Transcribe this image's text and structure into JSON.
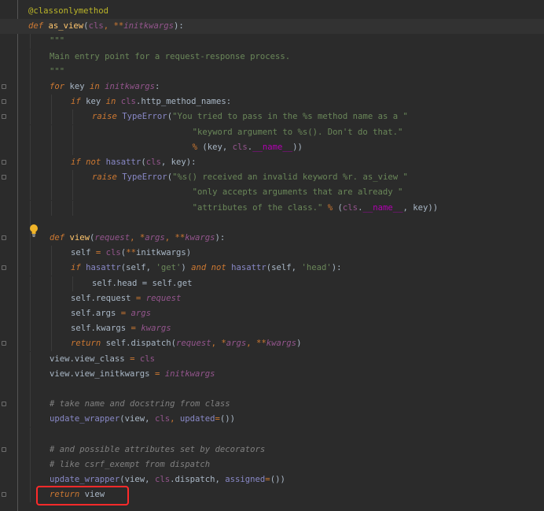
{
  "editor": {
    "lines": [
      {
        "tokens": [
          {
            "t": "@classonlymethod",
            "c": "deco"
          }
        ],
        "indent": 0
      },
      {
        "tokens": [
          {
            "t": "def ",
            "c": "kw"
          },
          {
            "t": "as_view",
            "c": "fn"
          },
          {
            "t": "(",
            "c": "attr"
          },
          {
            "t": "cls",
            "c": "self"
          },
          {
            "t": ", ",
            "c": "op"
          },
          {
            "t": "**",
            "c": "op"
          },
          {
            "t": "initkwargs",
            "c": "paramI"
          },
          {
            "t": "):",
            "c": "attr"
          }
        ],
        "indent": 0,
        "current": true
      },
      {
        "tokens": [
          {
            "t": "\"\"\"",
            "c": "str"
          }
        ],
        "indent": 1
      },
      {
        "tokens": [
          {
            "t": "Main entry point for a request-response process.",
            "c": "str"
          }
        ],
        "indent": 1
      },
      {
        "tokens": [
          {
            "t": "\"\"\"",
            "c": "str"
          }
        ],
        "indent": 1
      },
      {
        "tokens": [
          {
            "t": "for ",
            "c": "kw"
          },
          {
            "t": "key ",
            "c": "attr"
          },
          {
            "t": "in ",
            "c": "kw"
          },
          {
            "t": "initkwargs",
            "c": "paramI"
          },
          {
            "t": ":",
            "c": "attr"
          }
        ],
        "indent": 1
      },
      {
        "tokens": [
          {
            "t": "if ",
            "c": "kw"
          },
          {
            "t": "key ",
            "c": "attr"
          },
          {
            "t": "in ",
            "c": "kw"
          },
          {
            "t": "cls",
            "c": "self"
          },
          {
            "t": ".http_method_names:",
            "c": "attr"
          }
        ],
        "indent": 2
      },
      {
        "tokens": [
          {
            "t": "raise ",
            "c": "kw"
          },
          {
            "t": "TypeError",
            "c": "builtin"
          },
          {
            "t": "(",
            "c": "attr"
          },
          {
            "t": "\"You tried to pass in the %s method name as a \"",
            "c": "str"
          }
        ],
        "indent": 3
      },
      {
        "tokens": [
          {
            "t": "                    ",
            "c": "attr"
          },
          {
            "t": "\"keyword argument to %s(). Don't do that.\"",
            "c": "str"
          }
        ],
        "indent": 3
      },
      {
        "tokens": [
          {
            "t": "                    ",
            "c": "attr"
          },
          {
            "t": "% ",
            "c": "op"
          },
          {
            "t": "(key, ",
            "c": "attr"
          },
          {
            "t": "cls",
            "c": "self"
          },
          {
            "t": ".",
            "c": "attr"
          },
          {
            "t": "__name__",
            "c": "magic"
          },
          {
            "t": "))",
            "c": "attr"
          }
        ],
        "indent": 3
      },
      {
        "tokens": [
          {
            "t": "if not ",
            "c": "kw"
          },
          {
            "t": "hasattr",
            "c": "builtin"
          },
          {
            "t": "(",
            "c": "attr"
          },
          {
            "t": "cls",
            "c": "self"
          },
          {
            "t": ", key):",
            "c": "attr"
          }
        ],
        "indent": 2
      },
      {
        "tokens": [
          {
            "t": "raise ",
            "c": "kw"
          },
          {
            "t": "TypeError",
            "c": "builtin"
          },
          {
            "t": "(",
            "c": "attr"
          },
          {
            "t": "\"%s() received an invalid keyword %r. as_view \"",
            "c": "str"
          }
        ],
        "indent": 3
      },
      {
        "tokens": [
          {
            "t": "                    ",
            "c": "attr"
          },
          {
            "t": "\"only accepts arguments that are already \"",
            "c": "str"
          }
        ],
        "indent": 3
      },
      {
        "tokens": [
          {
            "t": "                    ",
            "c": "attr"
          },
          {
            "t": "\"attributes of the class.\"",
            "c": "str"
          },
          {
            "t": " % ",
            "c": "op"
          },
          {
            "t": "(",
            "c": "attr"
          },
          {
            "t": "cls",
            "c": "self"
          },
          {
            "t": ".",
            "c": "attr"
          },
          {
            "t": "__name__",
            "c": "magic"
          },
          {
            "t": ", key))",
            "c": "attr"
          }
        ],
        "indent": 3
      },
      {
        "tokens": [],
        "indent": 1
      },
      {
        "tokens": [
          {
            "t": "def ",
            "c": "kw"
          },
          {
            "t": "view",
            "c": "fn"
          },
          {
            "t": "(",
            "c": "attr"
          },
          {
            "t": "request",
            "c": "paramI"
          },
          {
            "t": ", *",
            "c": "op"
          },
          {
            "t": "args",
            "c": "paramI"
          },
          {
            "t": ", **",
            "c": "op"
          },
          {
            "t": "kwargs",
            "c": "paramI"
          },
          {
            "t": "):",
            "c": "attr"
          }
        ],
        "indent": 1
      },
      {
        "tokens": [
          {
            "t": "self",
            "c": "attr"
          },
          {
            "t": " = ",
            "c": "op"
          },
          {
            "t": "cls",
            "c": "self"
          },
          {
            "t": "(",
            "c": "attr"
          },
          {
            "t": "**",
            "c": "op"
          },
          {
            "t": "initkwargs)",
            "c": "attr"
          }
        ],
        "indent": 2
      },
      {
        "tokens": [
          {
            "t": "if ",
            "c": "kw"
          },
          {
            "t": "hasattr",
            "c": "builtin"
          },
          {
            "t": "(self, ",
            "c": "attr"
          },
          {
            "t": "'get'",
            "c": "str"
          },
          {
            "t": ") ",
            "c": "attr"
          },
          {
            "t": "and not ",
            "c": "kw"
          },
          {
            "t": "hasattr",
            "c": "builtin"
          },
          {
            "t": "(self, ",
            "c": "attr"
          },
          {
            "t": "'head'",
            "c": "str"
          },
          {
            "t": "):",
            "c": "attr"
          }
        ],
        "indent": 2
      },
      {
        "tokens": [
          {
            "t": "self.head = self.get",
            "c": "attr"
          }
        ],
        "indent": 3
      },
      {
        "tokens": [
          {
            "t": "self.request ",
            "c": "attr"
          },
          {
            "t": "= ",
            "c": "op"
          },
          {
            "t": "request",
            "c": "paramI"
          }
        ],
        "indent": 2
      },
      {
        "tokens": [
          {
            "t": "self.args ",
            "c": "attr"
          },
          {
            "t": "= ",
            "c": "op"
          },
          {
            "t": "args",
            "c": "paramI"
          }
        ],
        "indent": 2
      },
      {
        "tokens": [
          {
            "t": "self.kwargs ",
            "c": "attr"
          },
          {
            "t": "= ",
            "c": "op"
          },
          {
            "t": "kwargs",
            "c": "paramI"
          }
        ],
        "indent": 2
      },
      {
        "tokens": [
          {
            "t": "return ",
            "c": "kw"
          },
          {
            "t": "self.dispatch(",
            "c": "attr"
          },
          {
            "t": "request",
            "c": "paramI"
          },
          {
            "t": ", *",
            "c": "op"
          },
          {
            "t": "args",
            "c": "paramI"
          },
          {
            "t": ", **",
            "c": "op"
          },
          {
            "t": "kwargs",
            "c": "paramI"
          },
          {
            "t": ")",
            "c": "attr"
          }
        ],
        "indent": 2
      },
      {
        "tokens": [
          {
            "t": "view.view_class ",
            "c": "attr"
          },
          {
            "t": "= ",
            "c": "op"
          },
          {
            "t": "cls",
            "c": "self"
          }
        ],
        "indent": 1
      },
      {
        "tokens": [
          {
            "t": "view.view_initkwargs ",
            "c": "attr"
          },
          {
            "t": "= ",
            "c": "op"
          },
          {
            "t": "initkwargs",
            "c": "paramI"
          }
        ],
        "indent": 1
      },
      {
        "tokens": [],
        "indent": 1
      },
      {
        "tokens": [
          {
            "t": "# take name and docstring from class",
            "c": "cmt"
          }
        ],
        "indent": 1
      },
      {
        "tokens": [
          {
            "t": "update_wrapper",
            "c": "builtin"
          },
          {
            "t": "(view, ",
            "c": "attr"
          },
          {
            "t": "cls",
            "c": "self"
          },
          {
            "t": ", ",
            "c": "op"
          },
          {
            "t": "updated",
            "c": "builtin"
          },
          {
            "t": "=",
            "c": "op"
          },
          {
            "t": "())",
            "c": "attr"
          }
        ],
        "indent": 1
      },
      {
        "tokens": [],
        "indent": 1
      },
      {
        "tokens": [
          {
            "t": "# and possible attributes set by decorators",
            "c": "cmt"
          }
        ],
        "indent": 1
      },
      {
        "tokens": [
          {
            "t": "# like csrf_exempt from dispatch",
            "c": "cmt"
          }
        ],
        "indent": 1
      },
      {
        "tokens": [
          {
            "t": "update_wrapper",
            "c": "builtin"
          },
          {
            "t": "(view, ",
            "c": "attr"
          },
          {
            "t": "cls",
            "c": "self"
          },
          {
            "t": ".dispatch, ",
            "c": "attr"
          },
          {
            "t": "assigned",
            "c": "builtin"
          },
          {
            "t": "=",
            "c": "op"
          },
          {
            "t": "())",
            "c": "attr"
          }
        ],
        "indent": 1
      },
      {
        "tokens": [
          {
            "t": "return ",
            "c": "kw"
          },
          {
            "t": "view",
            "c": "attr"
          }
        ],
        "indent": 1
      }
    ]
  },
  "colors": {
    "background": "#2b2b2b",
    "current_line": "#323232",
    "highlight_box": "#ff2a2a"
  },
  "icons": {
    "intention_bulb": "lightbulb-icon",
    "fold_marker": "fold-marker-icon"
  }
}
